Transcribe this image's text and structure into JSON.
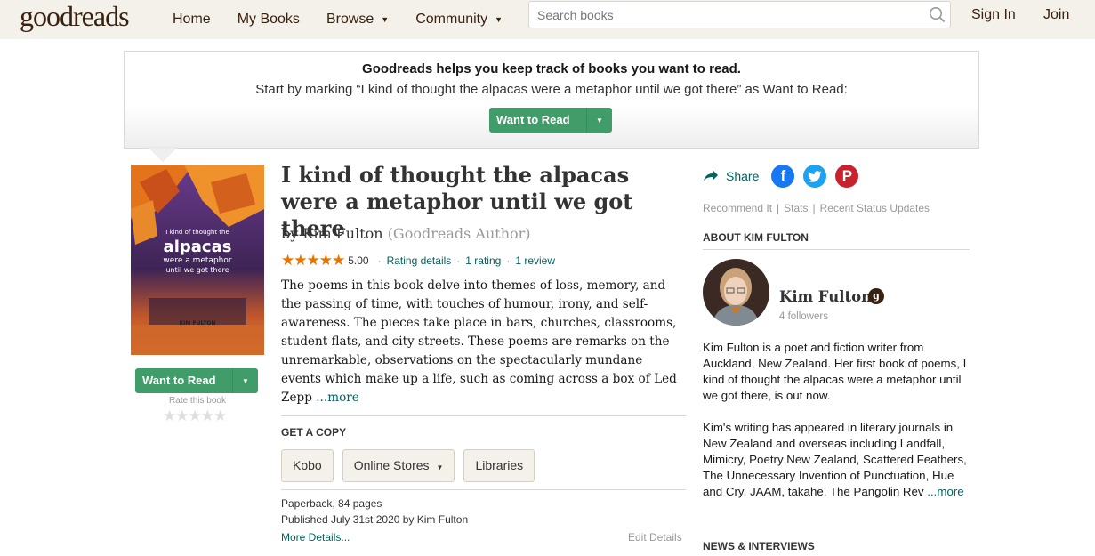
{
  "header": {
    "logo": "goodreads",
    "nav": [
      {
        "label": "Home",
        "caret": false
      },
      {
        "label": "My Books",
        "caret": false
      },
      {
        "label": "Browse",
        "caret": true
      },
      {
        "label": "Community",
        "caret": true
      }
    ],
    "search_placeholder": "Search books",
    "sign_in": "Sign In",
    "join": "Join"
  },
  "banner": {
    "title": "Goodreads helps you keep track of books you want to read.",
    "subtitle": "Start by marking “I kind of thought the alpacas were a metaphor until we got there” as Want to Read:",
    "button_label": "Want to Read"
  },
  "cover": {
    "line1": "I kind of thought the",
    "line2": "alpacas",
    "line3": "were a metaphor",
    "line4": "until we got there",
    "author": "KIM FULTON",
    "want_to_read": "Want to Read",
    "rate_label": "Rate this book",
    "rate_stars": "★★★★★"
  },
  "book": {
    "title": "I kind of thought the alpacas were a metaphor until we got there",
    "by": "by",
    "author": "Kim Fulton",
    "author_role": "(Goodreads Author)",
    "stars": "★★★★★",
    "average": "5.00",
    "rating_details": "Rating details",
    "ratings_count": "1 rating",
    "reviews_count": "1 review",
    "description": "The poems in this book delve into themes of loss, memory, and the passing of time, with touches of humour, irony, and self-awareness. The pieces take place in bars, churches, classrooms, student flats, and city streets. These poems are remarks on the unremarkable, observations on the spectacularly mundane events which make up a life, such as coming across a box of Led Zepp",
    "more": "...more",
    "get_a_copy": "GET A COPY",
    "copy_buttons": [
      "Kobo",
      "Online Stores",
      "Libraries"
    ],
    "format": "Paperback, 84 pages",
    "published": "Published July 31st 2020 by Kim Fulton",
    "more_details": "More Details...",
    "edit_details": "Edit Details"
  },
  "sidebar": {
    "share": "Share",
    "links": [
      "Recommend It",
      "Stats",
      "Recent Status Updates"
    ],
    "about_title": "ABOUT KIM FULTON",
    "author_name": "Kim Fulton",
    "badge": "g",
    "followers": "4 followers",
    "bio1": "Kim Fulton is a poet and fiction writer from Auckland, New Zealand. Her first book of poems, I kind of thought the alpacas were a metaphor until we got there, is out now.",
    "bio2": "Kim's writing has appeared in literary journals in New Zealand and overseas including Landfall, Mimicry, Poetry New Zealand, Scattered Feathers, The Unnecessary Invention of Punctuation, Hue and Cry, JAAM, takahē, The Pangolin Rev",
    "bio_more": "...more",
    "news_title": "NEWS & INTERVIEWS"
  },
  "colors": {
    "header_bg": "#f4f1ea",
    "brand_brown": "#382110",
    "green_button": "#409d69",
    "link_teal": "#00635d",
    "star_orange": "#e87400"
  },
  "icons": {
    "search": "search-icon",
    "share": "share-arrow-icon",
    "facebook": "facebook-icon",
    "twitter": "twitter-icon",
    "pinterest": "pinterest-icon"
  }
}
